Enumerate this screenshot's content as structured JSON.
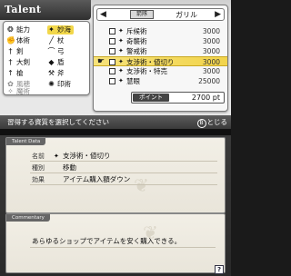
{
  "header": {
    "title": "Talent"
  },
  "categories": [
    {
      "label": "能力",
      "icon": "❂",
      "state": "normal"
    },
    {
      "label": "妙海",
      "icon": "✦",
      "state": "selected"
    },
    {
      "label": "体術",
      "icon": "✊",
      "state": "normal"
    },
    {
      "label": "杖",
      "icon": "╱",
      "state": "normal"
    },
    {
      "label": "剣",
      "icon": "†",
      "state": "normal"
    },
    {
      "label": "弓",
      "icon": "⌒",
      "state": "normal"
    },
    {
      "label": "大剣",
      "icon": "†",
      "state": "normal"
    },
    {
      "label": "盾",
      "icon": "◆",
      "state": "normal"
    },
    {
      "label": "槍",
      "icon": "↑",
      "state": "normal"
    },
    {
      "label": "斧",
      "icon": "⚒",
      "state": "normal"
    },
    {
      "label": "風穂",
      "icon": "✿",
      "state": "dim"
    },
    {
      "label": "印術",
      "icon": "✺",
      "state": "normal"
    },
    {
      "label": "魔術",
      "icon": "✧",
      "state": "dim"
    }
  ],
  "character": {
    "name": "ガリル",
    "emblem": "箭隊",
    "prev_arrow": "◀",
    "next_arrow": "▶"
  },
  "skills": [
    {
      "name": "斥候術",
      "cost": "3000",
      "icon": "✦",
      "highlighted": false
    },
    {
      "name": "奇襲術",
      "cost": "3000",
      "icon": "✦",
      "highlighted": false
    },
    {
      "name": "警戒術",
      "cost": "3000",
      "icon": "✦",
      "highlighted": false
    },
    {
      "name": "支渉術・値切り",
      "cost": "3000",
      "icon": "✦",
      "highlighted": true
    },
    {
      "name": "支渉術・特売",
      "cost": "3000",
      "icon": "✦",
      "highlighted": false
    },
    {
      "name": "慧眼",
      "cost": "25000",
      "icon": "✦",
      "highlighted": false
    }
  ],
  "points": {
    "label": "ポイント",
    "value": "2700 pt"
  },
  "hint": {
    "text": "習得する資質を選択してください",
    "close_label": "とじる",
    "close_icon": "B"
  },
  "details": {
    "section_title": "Talent Data",
    "rows": [
      {
        "label": "名前",
        "value": "支渉術・値切り",
        "icon": "✦"
      },
      {
        "label": "種別",
        "value": "移動",
        "icon": ""
      },
      {
        "label": "効果",
        "value": "アイテム購入額ダウン",
        "icon": ""
      }
    ]
  },
  "comment": {
    "section_title": "Commentary",
    "text": "あらゆるショップでアイテムを安く購入できる。"
  },
  "help": {
    "label": "?"
  }
}
